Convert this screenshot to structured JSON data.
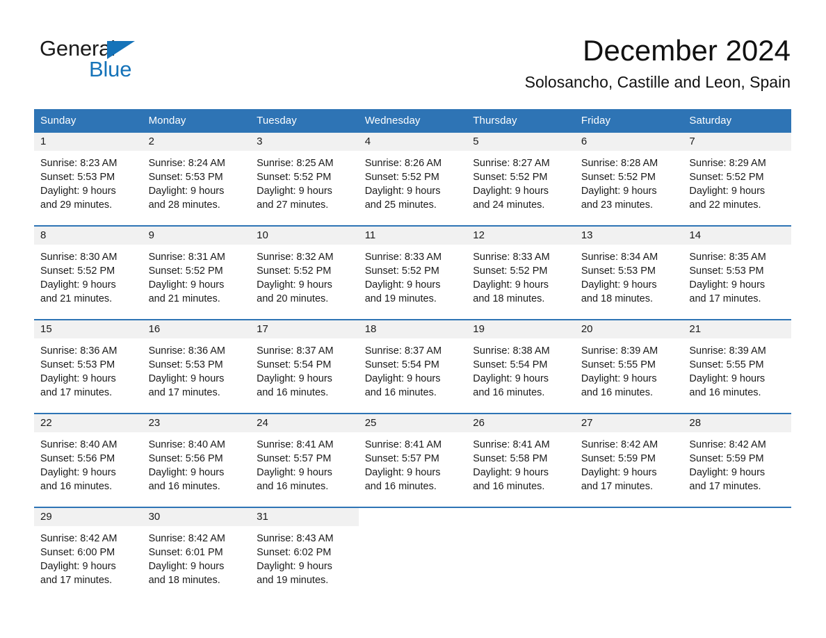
{
  "brand": {
    "word_one": "General",
    "word_two": "Blue",
    "triangle_color": "#1573b9",
    "blue_text_color": "#1573b9"
  },
  "header": {
    "month_title": "December 2024",
    "location": "Solosancho, Castille and Leon, Spain"
  },
  "theme": {
    "header_blue": "#2e74b5",
    "row_divider_blue": "#2e74b5",
    "daynum_band_gray": "#f1f1f1",
    "text_color": "#1a1a1a",
    "page_background": "#ffffff"
  },
  "calendar": {
    "weekday_headers": [
      "Sunday",
      "Monday",
      "Tuesday",
      "Wednesday",
      "Thursday",
      "Friday",
      "Saturday"
    ],
    "weeks": [
      [
        {
          "day": "1",
          "lines": [
            "Sunrise: 8:23 AM",
            "Sunset: 5:53 PM",
            "Daylight: 9 hours",
            "and 29 minutes."
          ]
        },
        {
          "day": "2",
          "lines": [
            "Sunrise: 8:24 AM",
            "Sunset: 5:53 PM",
            "Daylight: 9 hours",
            "and 28 minutes."
          ]
        },
        {
          "day": "3",
          "lines": [
            "Sunrise: 8:25 AM",
            "Sunset: 5:52 PM",
            "Daylight: 9 hours",
            "and 27 minutes."
          ]
        },
        {
          "day": "4",
          "lines": [
            "Sunrise: 8:26 AM",
            "Sunset: 5:52 PM",
            "Daylight: 9 hours",
            "and 25 minutes."
          ]
        },
        {
          "day": "5",
          "lines": [
            "Sunrise: 8:27 AM",
            "Sunset: 5:52 PM",
            "Daylight: 9 hours",
            "and 24 minutes."
          ]
        },
        {
          "day": "6",
          "lines": [
            "Sunrise: 8:28 AM",
            "Sunset: 5:52 PM",
            "Daylight: 9 hours",
            "and 23 minutes."
          ]
        },
        {
          "day": "7",
          "lines": [
            "Sunrise: 8:29 AM",
            "Sunset: 5:52 PM",
            "Daylight: 9 hours",
            "and 22 minutes."
          ]
        }
      ],
      [
        {
          "day": "8",
          "lines": [
            "Sunrise: 8:30 AM",
            "Sunset: 5:52 PM",
            "Daylight: 9 hours",
            "and 21 minutes."
          ]
        },
        {
          "day": "9",
          "lines": [
            "Sunrise: 8:31 AM",
            "Sunset: 5:52 PM",
            "Daylight: 9 hours",
            "and 21 minutes."
          ]
        },
        {
          "day": "10",
          "lines": [
            "Sunrise: 8:32 AM",
            "Sunset: 5:52 PM",
            "Daylight: 9 hours",
            "and 20 minutes."
          ]
        },
        {
          "day": "11",
          "lines": [
            "Sunrise: 8:33 AM",
            "Sunset: 5:52 PM",
            "Daylight: 9 hours",
            "and 19 minutes."
          ]
        },
        {
          "day": "12",
          "lines": [
            "Sunrise: 8:33 AM",
            "Sunset: 5:52 PM",
            "Daylight: 9 hours",
            "and 18 minutes."
          ]
        },
        {
          "day": "13",
          "lines": [
            "Sunrise: 8:34 AM",
            "Sunset: 5:53 PM",
            "Daylight: 9 hours",
            "and 18 minutes."
          ]
        },
        {
          "day": "14",
          "lines": [
            "Sunrise: 8:35 AM",
            "Sunset: 5:53 PM",
            "Daylight: 9 hours",
            "and 17 minutes."
          ]
        }
      ],
      [
        {
          "day": "15",
          "lines": [
            "Sunrise: 8:36 AM",
            "Sunset: 5:53 PM",
            "Daylight: 9 hours",
            "and 17 minutes."
          ]
        },
        {
          "day": "16",
          "lines": [
            "Sunrise: 8:36 AM",
            "Sunset: 5:53 PM",
            "Daylight: 9 hours",
            "and 17 minutes."
          ]
        },
        {
          "day": "17",
          "lines": [
            "Sunrise: 8:37 AM",
            "Sunset: 5:54 PM",
            "Daylight: 9 hours",
            "and 16 minutes."
          ]
        },
        {
          "day": "18",
          "lines": [
            "Sunrise: 8:37 AM",
            "Sunset: 5:54 PM",
            "Daylight: 9 hours",
            "and 16 minutes."
          ]
        },
        {
          "day": "19",
          "lines": [
            "Sunrise: 8:38 AM",
            "Sunset: 5:54 PM",
            "Daylight: 9 hours",
            "and 16 minutes."
          ]
        },
        {
          "day": "20",
          "lines": [
            "Sunrise: 8:39 AM",
            "Sunset: 5:55 PM",
            "Daylight: 9 hours",
            "and 16 minutes."
          ]
        },
        {
          "day": "21",
          "lines": [
            "Sunrise: 8:39 AM",
            "Sunset: 5:55 PM",
            "Daylight: 9 hours",
            "and 16 minutes."
          ]
        }
      ],
      [
        {
          "day": "22",
          "lines": [
            "Sunrise: 8:40 AM",
            "Sunset: 5:56 PM",
            "Daylight: 9 hours",
            "and 16 minutes."
          ]
        },
        {
          "day": "23",
          "lines": [
            "Sunrise: 8:40 AM",
            "Sunset: 5:56 PM",
            "Daylight: 9 hours",
            "and 16 minutes."
          ]
        },
        {
          "day": "24",
          "lines": [
            "Sunrise: 8:41 AM",
            "Sunset: 5:57 PM",
            "Daylight: 9 hours",
            "and 16 minutes."
          ]
        },
        {
          "day": "25",
          "lines": [
            "Sunrise: 8:41 AM",
            "Sunset: 5:57 PM",
            "Daylight: 9 hours",
            "and 16 minutes."
          ]
        },
        {
          "day": "26",
          "lines": [
            "Sunrise: 8:41 AM",
            "Sunset: 5:58 PM",
            "Daylight: 9 hours",
            "and 16 minutes."
          ]
        },
        {
          "day": "27",
          "lines": [
            "Sunrise: 8:42 AM",
            "Sunset: 5:59 PM",
            "Daylight: 9 hours",
            "and 17 minutes."
          ]
        },
        {
          "day": "28",
          "lines": [
            "Sunrise: 8:42 AM",
            "Sunset: 5:59 PM",
            "Daylight: 9 hours",
            "and 17 minutes."
          ]
        }
      ],
      [
        {
          "day": "29",
          "lines": [
            "Sunrise: 8:42 AM",
            "Sunset: 6:00 PM",
            "Daylight: 9 hours",
            "and 17 minutes."
          ]
        },
        {
          "day": "30",
          "lines": [
            "Sunrise: 8:42 AM",
            "Sunset: 6:01 PM",
            "Daylight: 9 hours",
            "and 18 minutes."
          ]
        },
        {
          "day": "31",
          "lines": [
            "Sunrise: 8:43 AM",
            "Sunset: 6:02 PM",
            "Daylight: 9 hours",
            "and 19 minutes."
          ]
        },
        {
          "day": "",
          "lines": []
        },
        {
          "day": "",
          "lines": []
        },
        {
          "day": "",
          "lines": []
        },
        {
          "day": "",
          "lines": []
        }
      ]
    ]
  }
}
